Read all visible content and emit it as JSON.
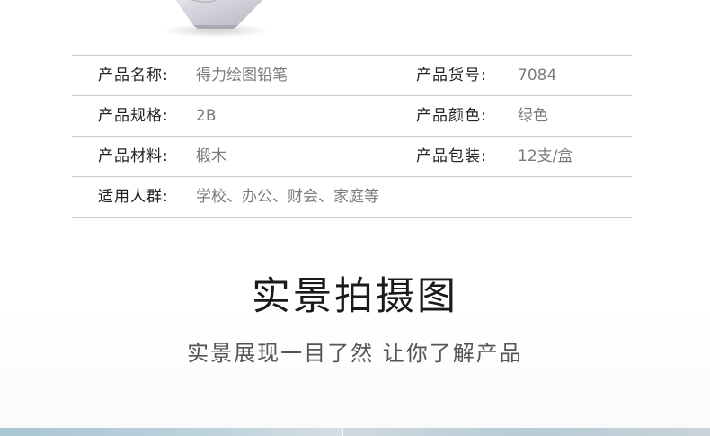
{
  "specs": {
    "rows": [
      {
        "left_label": "产品名称:",
        "left_value": "得力绘图铅笔",
        "right_label": "产品货号:",
        "right_value": "7084"
      },
      {
        "left_label": "产品规格:",
        "left_value": "2B",
        "right_label": "产品颜色:",
        "right_value": "绿色"
      },
      {
        "left_label": "产品材料:",
        "left_value": "椴木",
        "right_label": "产品包装:",
        "right_value": "12支/盒"
      },
      {
        "left_label": "适用人群:",
        "left_value": "学校、办公、财会、家庭等",
        "right_label": "",
        "right_value": ""
      }
    ]
  },
  "section": {
    "title": "实景拍摄图",
    "subtitle": "实景展现一目了然 让你了解产品"
  }
}
